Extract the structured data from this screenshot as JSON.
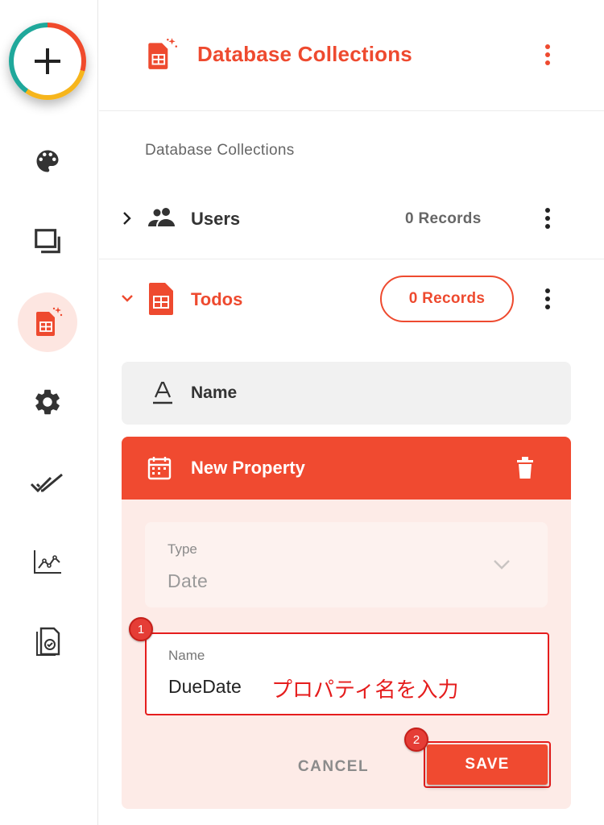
{
  "header": {
    "title": "Database Collections",
    "icon": "spreadsheet-sparkle-icon"
  },
  "sidebar": {
    "items": [
      {
        "name": "add",
        "icon": "plus-icon"
      },
      {
        "name": "theme",
        "icon": "palette-icon"
      },
      {
        "name": "pages",
        "icon": "layers-icon"
      },
      {
        "name": "database",
        "icon": "spreadsheet-sparkle-icon",
        "active": true
      },
      {
        "name": "settings",
        "icon": "gear-icon"
      },
      {
        "name": "tasks",
        "icon": "double-check-icon"
      },
      {
        "name": "analytics",
        "icon": "chart-line-icon"
      },
      {
        "name": "documents",
        "icon": "document-check-icon"
      }
    ]
  },
  "section_label": "Database Collections",
  "collections": [
    {
      "label": "Users",
      "records": "0 Records",
      "expanded": false,
      "icon": "users-icon"
    },
    {
      "label": "Todos",
      "records": "0 Records",
      "expanded": true,
      "icon": "spreadsheet-icon"
    }
  ],
  "properties": [
    {
      "label": "Name",
      "icon": "text-format-icon"
    }
  ],
  "new_property": {
    "title": "New Property",
    "type_label": "Type",
    "type_value": "Date",
    "name_label": "Name",
    "name_value": "DueDate",
    "name_annotation": "プロパティ名を入力",
    "cancel_label": "CANCEL",
    "save_label": "SAVE"
  },
  "annotations": {
    "step1": "1",
    "step2": "2"
  },
  "colors": {
    "accent": "#ee4a2f",
    "header_bar": "#f04a30",
    "annotation_red": "#e51d1d",
    "active_bg": "#fde6e1"
  }
}
